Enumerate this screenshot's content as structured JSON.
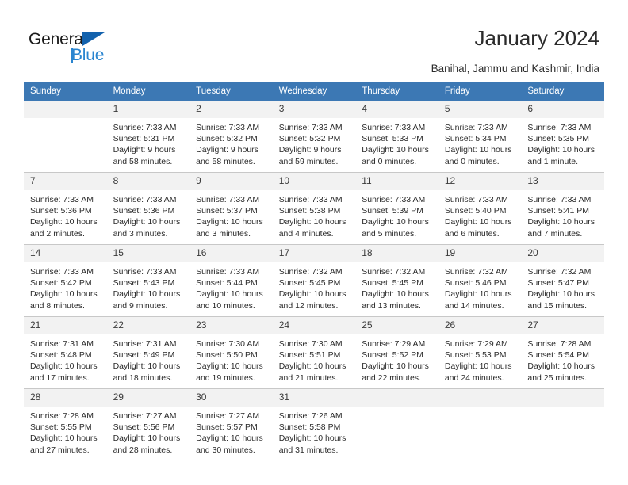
{
  "brand": {
    "name_dark": "General",
    "name_light": "Blue",
    "accent_dark": "#1362ad",
    "accent_light": "#2a85d0"
  },
  "header": {
    "title": "January 2024",
    "subtitle": "Banihal, Jammu and Kashmir, India",
    "header_bg": "#3c78b4",
    "daynum_bg": "#f2f2f2"
  },
  "weekday_headers": [
    "Sunday",
    "Monday",
    "Tuesday",
    "Wednesday",
    "Thursday",
    "Friday",
    "Saturday"
  ],
  "weeks": [
    [
      {
        "day": "",
        "sunrise": "",
        "sunset": "",
        "daylight_line1": "",
        "daylight_line2": ""
      },
      {
        "day": "1",
        "sunrise": "Sunrise: 7:33 AM",
        "sunset": "Sunset: 5:31 PM",
        "daylight_line1": "Daylight: 9 hours",
        "daylight_line2": "and 58 minutes."
      },
      {
        "day": "2",
        "sunrise": "Sunrise: 7:33 AM",
        "sunset": "Sunset: 5:32 PM",
        "daylight_line1": "Daylight: 9 hours",
        "daylight_line2": "and 58 minutes."
      },
      {
        "day": "3",
        "sunrise": "Sunrise: 7:33 AM",
        "sunset": "Sunset: 5:32 PM",
        "daylight_line1": "Daylight: 9 hours",
        "daylight_line2": "and 59 minutes."
      },
      {
        "day": "4",
        "sunrise": "Sunrise: 7:33 AM",
        "sunset": "Sunset: 5:33 PM",
        "daylight_line1": "Daylight: 10 hours",
        "daylight_line2": "and 0 minutes."
      },
      {
        "day": "5",
        "sunrise": "Sunrise: 7:33 AM",
        "sunset": "Sunset: 5:34 PM",
        "daylight_line1": "Daylight: 10 hours",
        "daylight_line2": "and 0 minutes."
      },
      {
        "day": "6",
        "sunrise": "Sunrise: 7:33 AM",
        "sunset": "Sunset: 5:35 PM",
        "daylight_line1": "Daylight: 10 hours",
        "daylight_line2": "and 1 minute."
      }
    ],
    [
      {
        "day": "7",
        "sunrise": "Sunrise: 7:33 AM",
        "sunset": "Sunset: 5:36 PM",
        "daylight_line1": "Daylight: 10 hours",
        "daylight_line2": "and 2 minutes."
      },
      {
        "day": "8",
        "sunrise": "Sunrise: 7:33 AM",
        "sunset": "Sunset: 5:36 PM",
        "daylight_line1": "Daylight: 10 hours",
        "daylight_line2": "and 3 minutes."
      },
      {
        "day": "9",
        "sunrise": "Sunrise: 7:33 AM",
        "sunset": "Sunset: 5:37 PM",
        "daylight_line1": "Daylight: 10 hours",
        "daylight_line2": "and 3 minutes."
      },
      {
        "day": "10",
        "sunrise": "Sunrise: 7:33 AM",
        "sunset": "Sunset: 5:38 PM",
        "daylight_line1": "Daylight: 10 hours",
        "daylight_line2": "and 4 minutes."
      },
      {
        "day": "11",
        "sunrise": "Sunrise: 7:33 AM",
        "sunset": "Sunset: 5:39 PM",
        "daylight_line1": "Daylight: 10 hours",
        "daylight_line2": "and 5 minutes."
      },
      {
        "day": "12",
        "sunrise": "Sunrise: 7:33 AM",
        "sunset": "Sunset: 5:40 PM",
        "daylight_line1": "Daylight: 10 hours",
        "daylight_line2": "and 6 minutes."
      },
      {
        "day": "13",
        "sunrise": "Sunrise: 7:33 AM",
        "sunset": "Sunset: 5:41 PM",
        "daylight_line1": "Daylight: 10 hours",
        "daylight_line2": "and 7 minutes."
      }
    ],
    [
      {
        "day": "14",
        "sunrise": "Sunrise: 7:33 AM",
        "sunset": "Sunset: 5:42 PM",
        "daylight_line1": "Daylight: 10 hours",
        "daylight_line2": "and 8 minutes."
      },
      {
        "day": "15",
        "sunrise": "Sunrise: 7:33 AM",
        "sunset": "Sunset: 5:43 PM",
        "daylight_line1": "Daylight: 10 hours",
        "daylight_line2": "and 9 minutes."
      },
      {
        "day": "16",
        "sunrise": "Sunrise: 7:33 AM",
        "sunset": "Sunset: 5:44 PM",
        "daylight_line1": "Daylight: 10 hours",
        "daylight_line2": "and 10 minutes."
      },
      {
        "day": "17",
        "sunrise": "Sunrise: 7:32 AM",
        "sunset": "Sunset: 5:45 PM",
        "daylight_line1": "Daylight: 10 hours",
        "daylight_line2": "and 12 minutes."
      },
      {
        "day": "18",
        "sunrise": "Sunrise: 7:32 AM",
        "sunset": "Sunset: 5:45 PM",
        "daylight_line1": "Daylight: 10 hours",
        "daylight_line2": "and 13 minutes."
      },
      {
        "day": "19",
        "sunrise": "Sunrise: 7:32 AM",
        "sunset": "Sunset: 5:46 PM",
        "daylight_line1": "Daylight: 10 hours",
        "daylight_line2": "and 14 minutes."
      },
      {
        "day": "20",
        "sunrise": "Sunrise: 7:32 AM",
        "sunset": "Sunset: 5:47 PM",
        "daylight_line1": "Daylight: 10 hours",
        "daylight_line2": "and 15 minutes."
      }
    ],
    [
      {
        "day": "21",
        "sunrise": "Sunrise: 7:31 AM",
        "sunset": "Sunset: 5:48 PM",
        "daylight_line1": "Daylight: 10 hours",
        "daylight_line2": "and 17 minutes."
      },
      {
        "day": "22",
        "sunrise": "Sunrise: 7:31 AM",
        "sunset": "Sunset: 5:49 PM",
        "daylight_line1": "Daylight: 10 hours",
        "daylight_line2": "and 18 minutes."
      },
      {
        "day": "23",
        "sunrise": "Sunrise: 7:30 AM",
        "sunset": "Sunset: 5:50 PM",
        "daylight_line1": "Daylight: 10 hours",
        "daylight_line2": "and 19 minutes."
      },
      {
        "day": "24",
        "sunrise": "Sunrise: 7:30 AM",
        "sunset": "Sunset: 5:51 PM",
        "daylight_line1": "Daylight: 10 hours",
        "daylight_line2": "and 21 minutes."
      },
      {
        "day": "25",
        "sunrise": "Sunrise: 7:29 AM",
        "sunset": "Sunset: 5:52 PM",
        "daylight_line1": "Daylight: 10 hours",
        "daylight_line2": "and 22 minutes."
      },
      {
        "day": "26",
        "sunrise": "Sunrise: 7:29 AM",
        "sunset": "Sunset: 5:53 PM",
        "daylight_line1": "Daylight: 10 hours",
        "daylight_line2": "and 24 minutes."
      },
      {
        "day": "27",
        "sunrise": "Sunrise: 7:28 AM",
        "sunset": "Sunset: 5:54 PM",
        "daylight_line1": "Daylight: 10 hours",
        "daylight_line2": "and 25 minutes."
      }
    ],
    [
      {
        "day": "28",
        "sunrise": "Sunrise: 7:28 AM",
        "sunset": "Sunset: 5:55 PM",
        "daylight_line1": "Daylight: 10 hours",
        "daylight_line2": "and 27 minutes."
      },
      {
        "day": "29",
        "sunrise": "Sunrise: 7:27 AM",
        "sunset": "Sunset: 5:56 PM",
        "daylight_line1": "Daylight: 10 hours",
        "daylight_line2": "and 28 minutes."
      },
      {
        "day": "30",
        "sunrise": "Sunrise: 7:27 AM",
        "sunset": "Sunset: 5:57 PM",
        "daylight_line1": "Daylight: 10 hours",
        "daylight_line2": "and 30 minutes."
      },
      {
        "day": "31",
        "sunrise": "Sunrise: 7:26 AM",
        "sunset": "Sunset: 5:58 PM",
        "daylight_line1": "Daylight: 10 hours",
        "daylight_line2": "and 31 minutes."
      },
      {
        "day": "",
        "sunrise": "",
        "sunset": "",
        "daylight_line1": "",
        "daylight_line2": ""
      },
      {
        "day": "",
        "sunrise": "",
        "sunset": "",
        "daylight_line1": "",
        "daylight_line2": ""
      },
      {
        "day": "",
        "sunrise": "",
        "sunset": "",
        "daylight_line1": "",
        "daylight_line2": ""
      }
    ]
  ]
}
